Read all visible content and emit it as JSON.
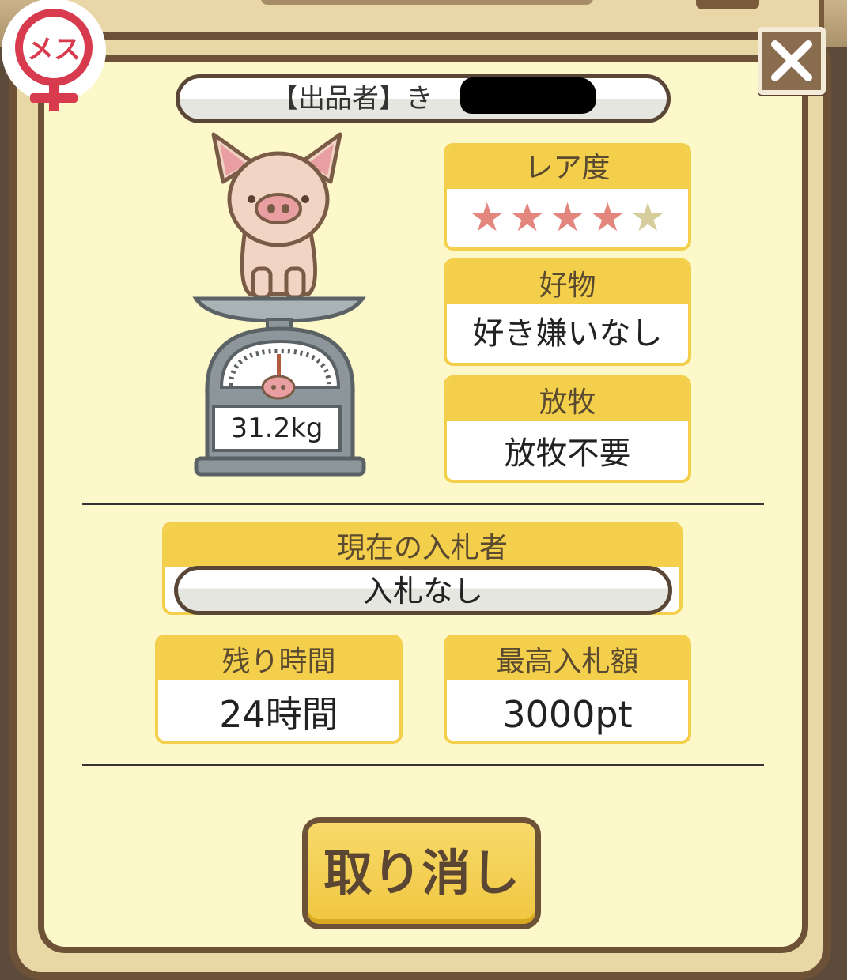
{
  "seller": {
    "label": "【出品者】き"
  },
  "badge": {
    "gender_label": "メス"
  },
  "weight": {
    "value": "31.2kg"
  },
  "rarity": {
    "label": "レア度",
    "stars_filled": 4,
    "stars_total": 5,
    "star_char": "★"
  },
  "favorite": {
    "label": "好物",
    "value": "好き嫌いなし"
  },
  "grazing": {
    "label": "放牧",
    "value": "放牧不要"
  },
  "bidder": {
    "label": "現在の入札者",
    "value": "入札なし"
  },
  "time_left": {
    "label": "残り時間",
    "value": "24時間"
  },
  "max_bid": {
    "label": "最高入札額",
    "value": "3000pt"
  },
  "cancel_button": {
    "label": "取り消し"
  },
  "colors": {
    "accent_yellow": "#f4cf4c",
    "frame_brown": "#6e5238",
    "panel": "#fdf8c9",
    "female_red": "#d83a4e"
  },
  "icons": {
    "close": "close-icon",
    "gender": "female-icon",
    "pig": "pig-icon",
    "scale": "scale-icon"
  }
}
